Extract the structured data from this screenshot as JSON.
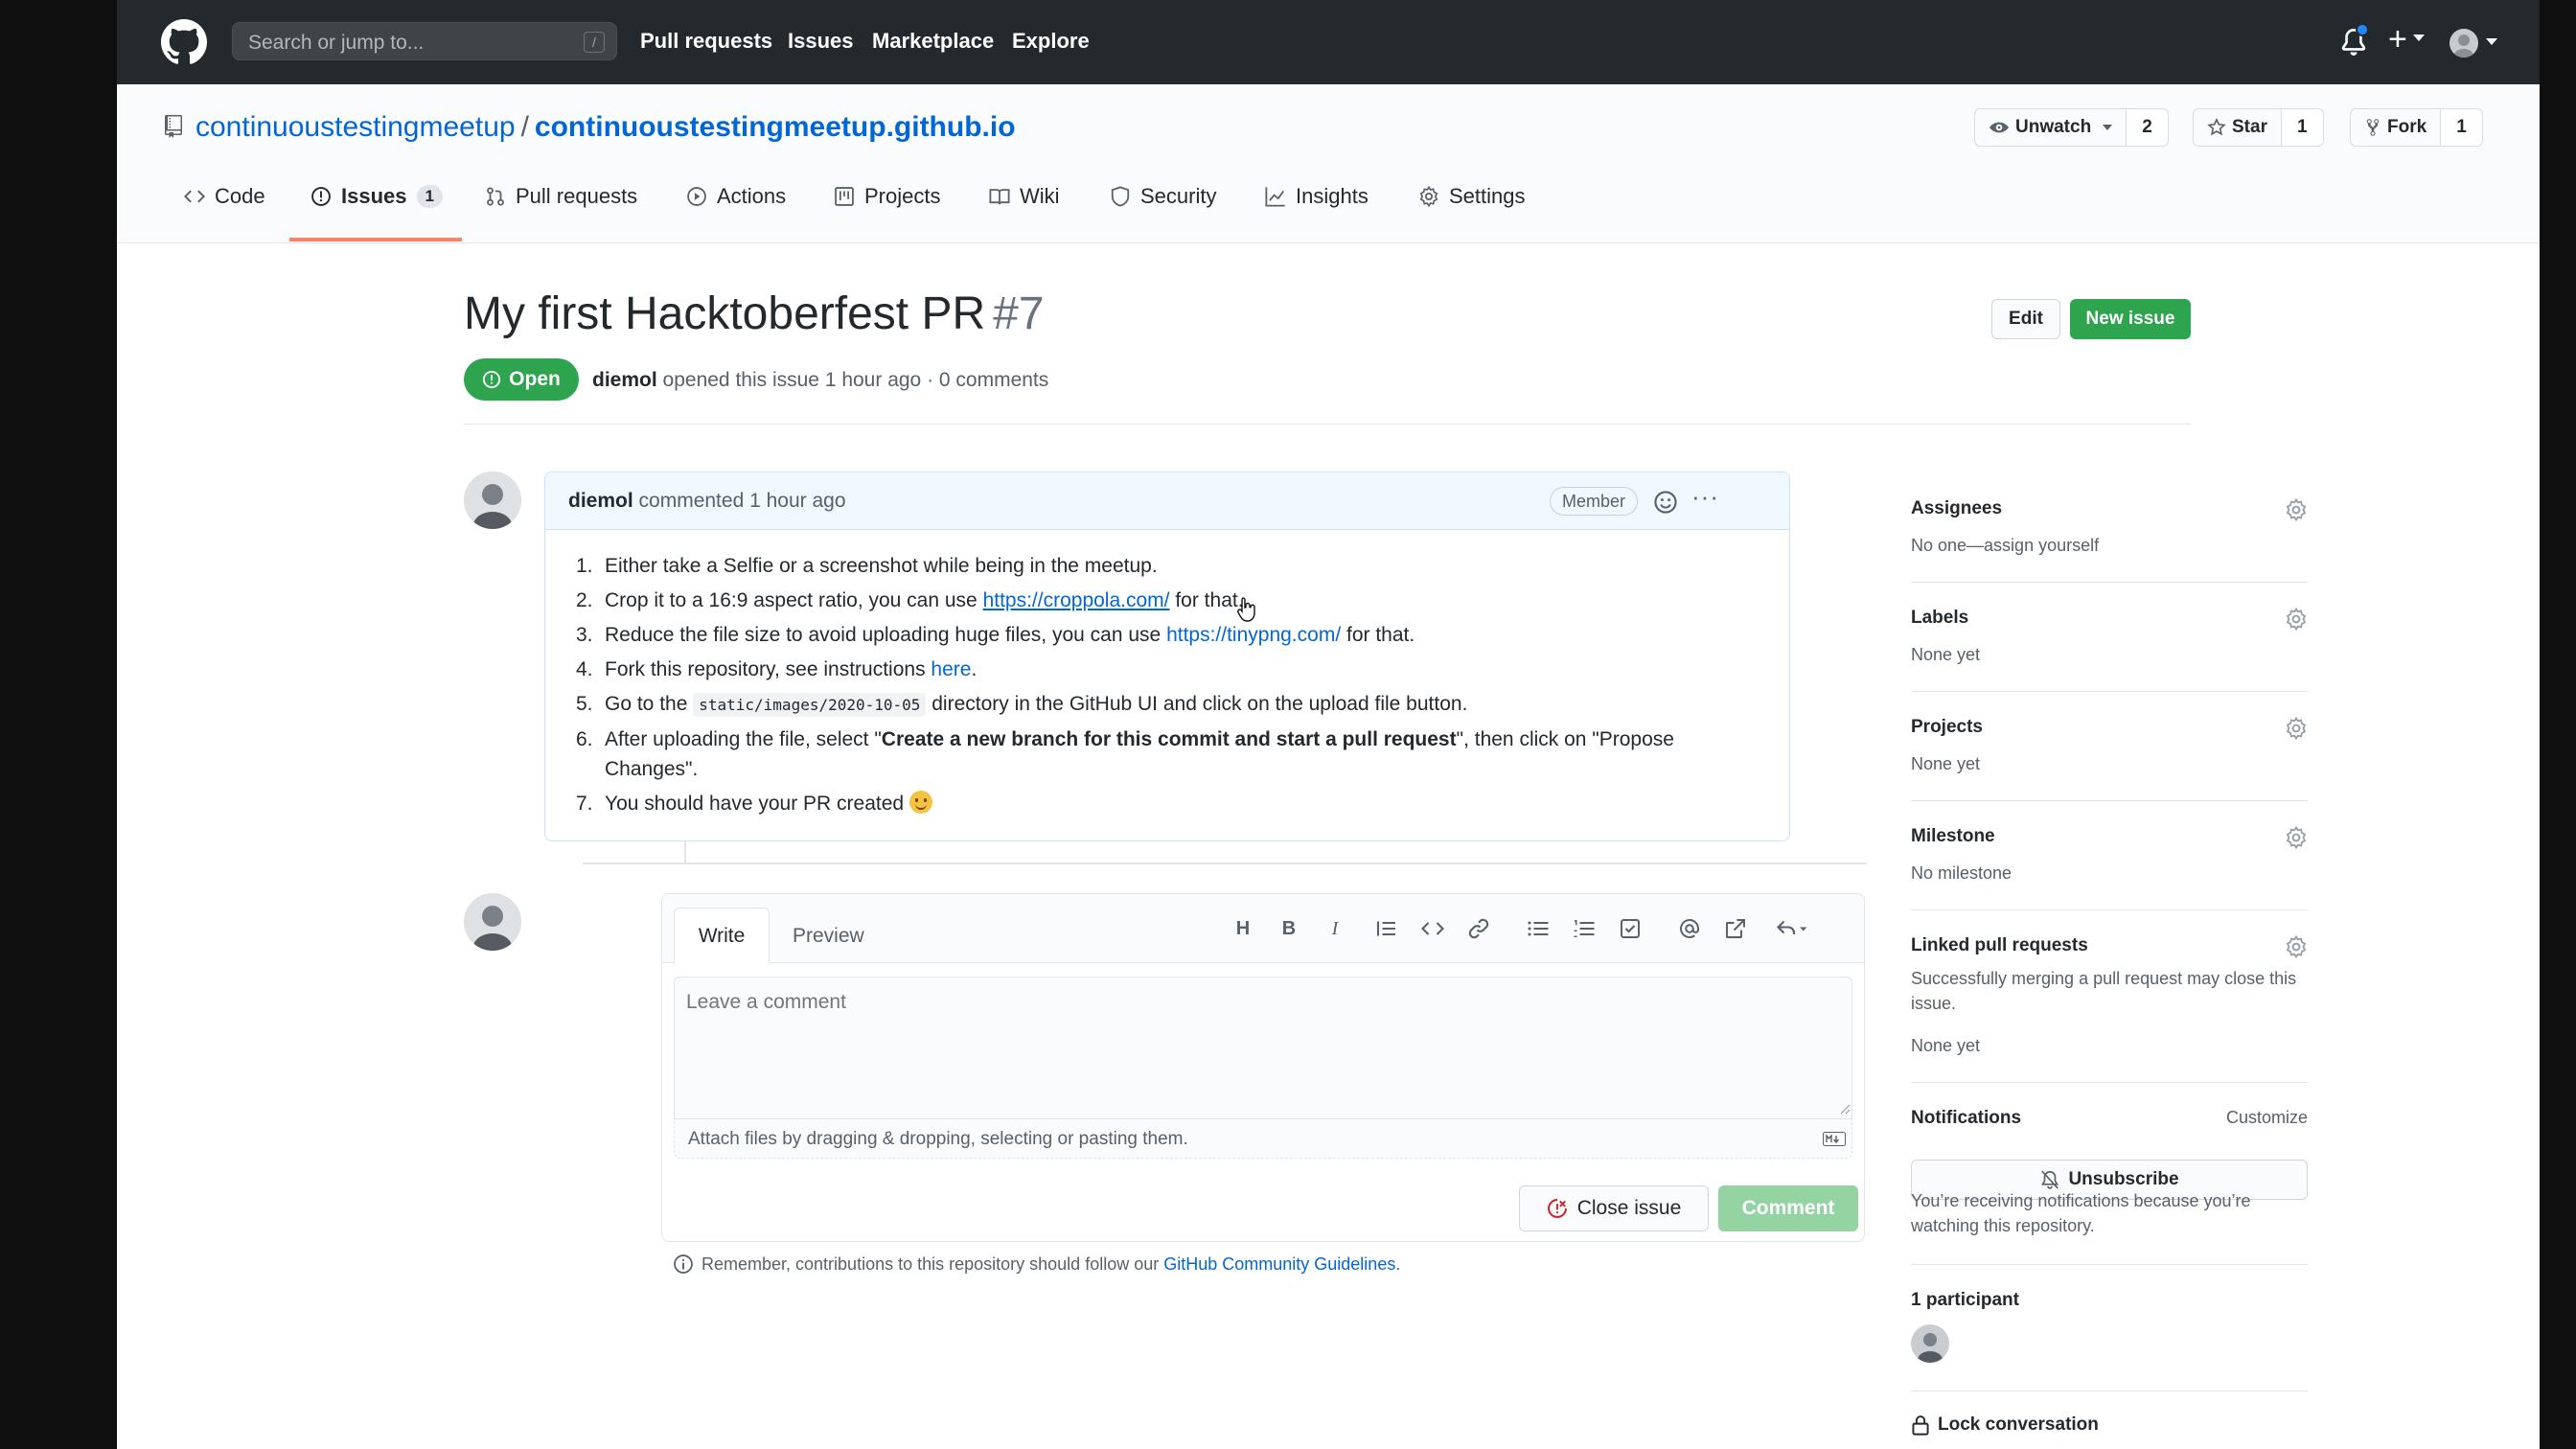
{
  "header": {
    "search_placeholder": "Search or jump to...",
    "search_shortcut": "/",
    "nav": [
      "Pull requests",
      "Issues",
      "Marketplace",
      "Explore"
    ]
  },
  "repo": {
    "owner": "continuoustestingmeetup",
    "separator": "/",
    "name": "continuoustestingmeetup.github.io",
    "watch_label": "Unwatch",
    "watch_count": "2",
    "star_label": "Star",
    "star_count": "1",
    "fork_label": "Fork",
    "fork_count": "1"
  },
  "tabs": [
    {
      "label": "Code",
      "icon": "code-icon"
    },
    {
      "label": "Issues",
      "icon": "issue-icon",
      "counter": "1",
      "selected": true
    },
    {
      "label": "Pull requests",
      "icon": "pull-request-icon"
    },
    {
      "label": "Actions",
      "icon": "play-icon"
    },
    {
      "label": "Projects",
      "icon": "project-icon"
    },
    {
      "label": "Wiki",
      "icon": "book-icon"
    },
    {
      "label": "Security",
      "icon": "shield-icon"
    },
    {
      "label": "Insights",
      "icon": "graph-icon"
    },
    {
      "label": "Settings",
      "icon": "gear-icon"
    }
  ],
  "issue": {
    "title": "My first Hacktoberfest PR",
    "number": "#7",
    "edit_label": "Edit",
    "new_issue_label": "New issue",
    "state": "Open",
    "author": "diemol",
    "meta": "opened this issue 1 hour ago · 0 comments"
  },
  "comment": {
    "author": "diemol",
    "action": "commented 1 hour ago",
    "badge": "Member",
    "steps": [
      {
        "n": "1.",
        "pre": "Either take a Selfie or a screenshot while being in the meetup."
      },
      {
        "n": "2.",
        "pre": "Crop it to a 16:9 aspect ratio, you can use ",
        "link": "https://croppola.com/",
        "post": " for that."
      },
      {
        "n": "3.",
        "pre": "Reduce the file size to avoid uploading huge files, you can use ",
        "link": "https://tinypng.com/",
        "post": " for that."
      },
      {
        "n": "4.",
        "pre": "Fork this repository, see instructions ",
        "link": "here",
        "post": "."
      },
      {
        "n": "5.",
        "pre": "Go to the ",
        "code": "static/images/2020-10-05",
        "post": " directory in the GitHub UI and click on the upload file button."
      },
      {
        "n": "6.",
        "pre": "After uploading the file, select \"",
        "bold": "Create a new branch for this commit and start a pull request",
        "post": "\", then click on \"Propose Changes\"."
      },
      {
        "n": "7.",
        "pre": "You should have your PR created "
      }
    ]
  },
  "form": {
    "write_tab": "Write",
    "preview_tab": "Preview",
    "placeholder": "Leave a comment",
    "attach_text": "Attach files by dragging & dropping, selecting or pasting them.",
    "close_label": "Close issue",
    "comment_label": "Comment",
    "guideline_pre": "Remember, contributions to this repository should follow our ",
    "guideline_link": "GitHub Community Guidelines",
    "guideline_post": "."
  },
  "sidebar": {
    "assignees_title": "Assignees",
    "assignees_value": "No one—assign yourself",
    "labels_title": "Labels",
    "labels_value": "None yet",
    "projects_title": "Projects",
    "projects_value": "None yet",
    "milestone_title": "Milestone",
    "milestone_value": "No milestone",
    "linked_title": "Linked pull requests",
    "linked_desc": "Successfully merging a pull request may close this issue.",
    "linked_value": "None yet",
    "notifications_title": "Notifications",
    "customize": "Customize",
    "unsubscribe": "Unsubscribe",
    "notif_reason": "You’re receiving notifications because you’re watching this repository.",
    "participants_title": "1 participant",
    "lock_label": "Lock conversation"
  },
  "colors": {
    "header_bg": "#24292e",
    "link": "#0366d6",
    "open_green": "#2ea44f",
    "tab_underline": "#f9826c"
  }
}
